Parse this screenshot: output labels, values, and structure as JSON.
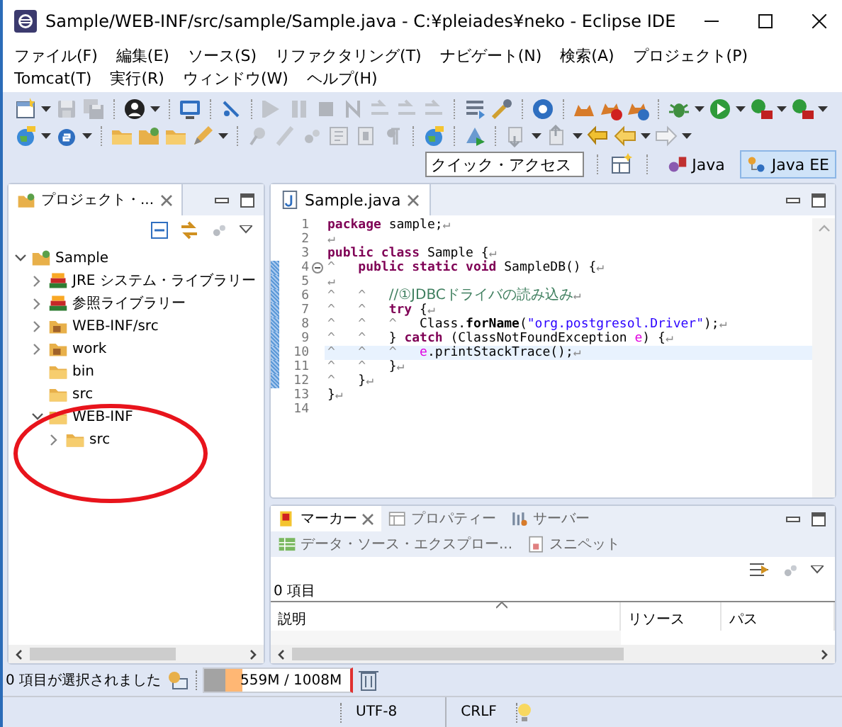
{
  "window": {
    "title": "Sample/WEB-INF/src/sample/Sample.java - C:¥pleiades¥neko - Eclipse IDE"
  },
  "menu": [
    "ファイル(F)",
    "編集(E)",
    "ソース(S)",
    "リファクタリング(T)",
    "ナビゲート(N)",
    "検索(A)",
    "プロジェクト(P)",
    "Tomcat(T)",
    "実行(R)",
    "ウィンドウ(W)",
    "ヘルプ(H)"
  ],
  "quick_access": {
    "placeholder": "クイック・アクセス"
  },
  "perspectives": [
    {
      "label": "Java",
      "selected": false
    },
    {
      "label": "Java EE",
      "selected": true
    }
  ],
  "project_explorer": {
    "tab": {
      "title": "プロジェクト・..."
    },
    "tree": [
      {
        "label": "Sample",
        "kind": "project",
        "expanded": true,
        "children": [
          {
            "label": "JRE システム・ライブラリー",
            "kind": "library",
            "expanded": false
          },
          {
            "label": "参照ライブラリー",
            "kind": "library",
            "expanded": false
          },
          {
            "label": "WEB-INF/src",
            "kind": "source",
            "expanded": false
          },
          {
            "label": "work",
            "kind": "source",
            "expanded": false
          },
          {
            "label": "bin",
            "kind": "folder"
          },
          {
            "label": "src",
            "kind": "folder"
          },
          {
            "label": "WEB-INF",
            "kind": "folder",
            "expanded": true,
            "children": [
              {
                "label": "src",
                "kind": "folder",
                "expanded": false
              }
            ]
          }
        ]
      }
    ]
  },
  "editor": {
    "tab": {
      "title": "Sample.java"
    },
    "lines": [
      {
        "number": "1",
        "changed": false,
        "current": false,
        "tokens": [
          {
            "kind": "keyword",
            "text": "package"
          },
          {
            "kind": "plain",
            "text": " sample;"
          },
          {
            "kind": "eol",
            "text": "↵"
          }
        ]
      },
      {
        "number": "2",
        "changed": false,
        "current": false,
        "tokens": [
          {
            "kind": "eol",
            "text": "↵"
          }
        ]
      },
      {
        "number": "3",
        "changed": false,
        "current": false,
        "tokens": [
          {
            "kind": "keyword",
            "text": "public class"
          },
          {
            "kind": "plain",
            "text": " Sample {"
          },
          {
            "kind": "eol",
            "text": "↵"
          }
        ]
      },
      {
        "number": "4",
        "changed": true,
        "current": false,
        "folded": false,
        "tokens": [
          {
            "kind": "tab",
            "text": "^"
          },
          {
            "kind": "keyword",
            "text": "public static void"
          },
          {
            "kind": "plain",
            "text": " SampleDB() {"
          },
          {
            "kind": "eol",
            "text": "↵"
          }
        ]
      },
      {
        "number": "5",
        "changed": true,
        "current": false,
        "tokens": [
          {
            "kind": "eol",
            "text": "↵"
          }
        ]
      },
      {
        "number": "6",
        "changed": true,
        "current": false,
        "tokens": [
          {
            "kind": "tab",
            "text": "^"
          },
          {
            "kind": "tab",
            "text": "^"
          },
          {
            "kind": "comment",
            "text": "//①JDBCドライバの読み込み"
          },
          {
            "kind": "eol",
            "text": "↵"
          }
        ]
      },
      {
        "number": "7",
        "changed": true,
        "current": false,
        "tokens": [
          {
            "kind": "tab",
            "text": "^"
          },
          {
            "kind": "tab",
            "text": "^"
          },
          {
            "kind": "keyword",
            "text": "try"
          },
          {
            "kind": "plain",
            "text": " {"
          },
          {
            "kind": "eol",
            "text": "↵"
          }
        ]
      },
      {
        "number": "8",
        "changed": true,
        "current": false,
        "tokens": [
          {
            "kind": "tab",
            "text": "^"
          },
          {
            "kind": "tab",
            "text": "^"
          },
          {
            "kind": "tab",
            "text": "^"
          },
          {
            "kind": "plain",
            "text": "Class."
          },
          {
            "kind": "method",
            "text": "forName"
          },
          {
            "kind": "plain",
            "text": "("
          },
          {
            "kind": "string",
            "text": "\"org.postgresol.Driver\""
          },
          {
            "kind": "plain",
            "text": ");"
          },
          {
            "kind": "eol",
            "text": "↵"
          }
        ]
      },
      {
        "number": "9",
        "changed": true,
        "current": false,
        "tokens": [
          {
            "kind": "tab",
            "text": "^"
          },
          {
            "kind": "tab",
            "text": "^"
          },
          {
            "kind": "plain",
            "text": "} "
          },
          {
            "kind": "keyword",
            "text": "catch"
          },
          {
            "kind": "plain",
            "text": " (ClassNotFoundException "
          },
          {
            "kind": "variable",
            "text": "e"
          },
          {
            "kind": "plain",
            "text": ") {"
          },
          {
            "kind": "eol",
            "text": "↵"
          }
        ]
      },
      {
        "number": "10",
        "changed": true,
        "current": true,
        "tokens": [
          {
            "kind": "tab",
            "text": "^"
          },
          {
            "kind": "tab",
            "text": "^"
          },
          {
            "kind": "tab",
            "text": "^"
          },
          {
            "kind": "variable",
            "text": "e"
          },
          {
            "kind": "plain",
            "text": ".printStackTrace();"
          },
          {
            "kind": "eol",
            "text": "↵"
          }
        ]
      },
      {
        "number": "11",
        "changed": true,
        "current": false,
        "tokens": [
          {
            "kind": "tab",
            "text": "^"
          },
          {
            "kind": "tab",
            "text": "^"
          },
          {
            "kind": "plain",
            "text": "}"
          },
          {
            "kind": "eol",
            "text": "↵"
          }
        ]
      },
      {
        "number": "12",
        "changed": true,
        "current": false,
        "tokens": [
          {
            "kind": "tab",
            "text": "^"
          },
          {
            "kind": "plain",
            "text": "}"
          },
          {
            "kind": "eol",
            "text": "↵"
          }
        ]
      },
      {
        "number": "13",
        "changed": false,
        "current": false,
        "tokens": [
          {
            "kind": "plain",
            "text": "}"
          },
          {
            "kind": "eol",
            "text": "↵"
          }
        ]
      },
      {
        "number": "14",
        "changed": false,
        "current": false
      }
    ]
  },
  "bottom_panel": {
    "tabs": [
      {
        "label": "マーカー",
        "kind": "markers",
        "selected": true
      },
      {
        "label": "プロパティー",
        "kind": "properties",
        "selected": false
      },
      {
        "label": "サーバー",
        "kind": "servers",
        "selected": false
      },
      {
        "label": "データ・ソース・エクスプロー...",
        "kind": "datasource",
        "selected": false
      },
      {
        "label": "スニペット",
        "kind": "snippets",
        "selected": false
      }
    ],
    "count": "0 項目",
    "columns": [
      "説明",
      "リソース",
      "パス"
    ]
  },
  "status_bar": {
    "message": "0 項目が選択されました",
    "heap": {
      "reading": "559M / 1008M",
      "level": 0.27
    },
    "encoding": "UTF-8",
    "line_ending": "CRLF"
  }
}
